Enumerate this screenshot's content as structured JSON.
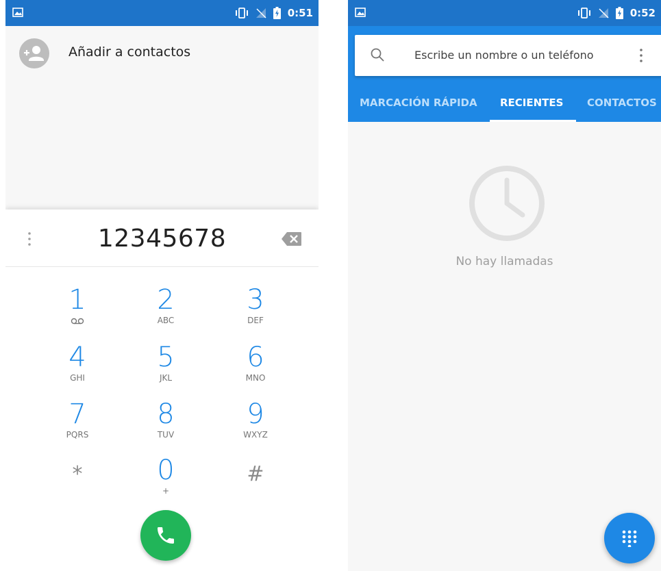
{
  "left_phone": {
    "status_bar": {
      "time": "0:51"
    },
    "add_contact_label": "Añadir a contactos",
    "dial_number": "12345678",
    "keys": [
      {
        "digit": "1",
        "letters": ""
      },
      {
        "digit": "2",
        "letters": "ABC"
      },
      {
        "digit": "3",
        "letters": "DEF"
      },
      {
        "digit": "4",
        "letters": "GHI"
      },
      {
        "digit": "5",
        "letters": "JKL"
      },
      {
        "digit": "6",
        "letters": "MNO"
      },
      {
        "digit": "7",
        "letters": "PQRS"
      },
      {
        "digit": "8",
        "letters": "TUV"
      },
      {
        "digit": "9",
        "letters": "WXYZ"
      },
      {
        "digit": "*",
        "letters": ""
      },
      {
        "digit": "0",
        "letters": "+"
      },
      {
        "digit": "#",
        "letters": ""
      }
    ]
  },
  "right_phone": {
    "status_bar": {
      "time": "0:52"
    },
    "search": {
      "placeholder": "Escribe un nombre o un teléfono"
    },
    "tabs": [
      {
        "label": "MARCACIÓN RÁPIDA",
        "active": false
      },
      {
        "label": "RECIENTES",
        "active": true
      },
      {
        "label": "CONTACTOS",
        "active": false
      }
    ],
    "empty_message": "No hay llamadas"
  },
  "colors": {
    "status_bar": "#1e74c9",
    "app_bar": "#1e88e5",
    "dial_digit": "#1e88e5",
    "call_button": "#21b559",
    "background": "#f7f7f7"
  },
  "icons": {
    "status": [
      "image-icon",
      "vibrate-icon",
      "no-signal-icon",
      "battery-charging-icon"
    ],
    "left": [
      "add-person-icon",
      "more-vert-icon",
      "backspace-icon",
      "voicemail-icon",
      "phone-icon"
    ],
    "right": [
      "search-icon",
      "more-vert-icon",
      "clock-icon",
      "dialpad-icon"
    ]
  }
}
